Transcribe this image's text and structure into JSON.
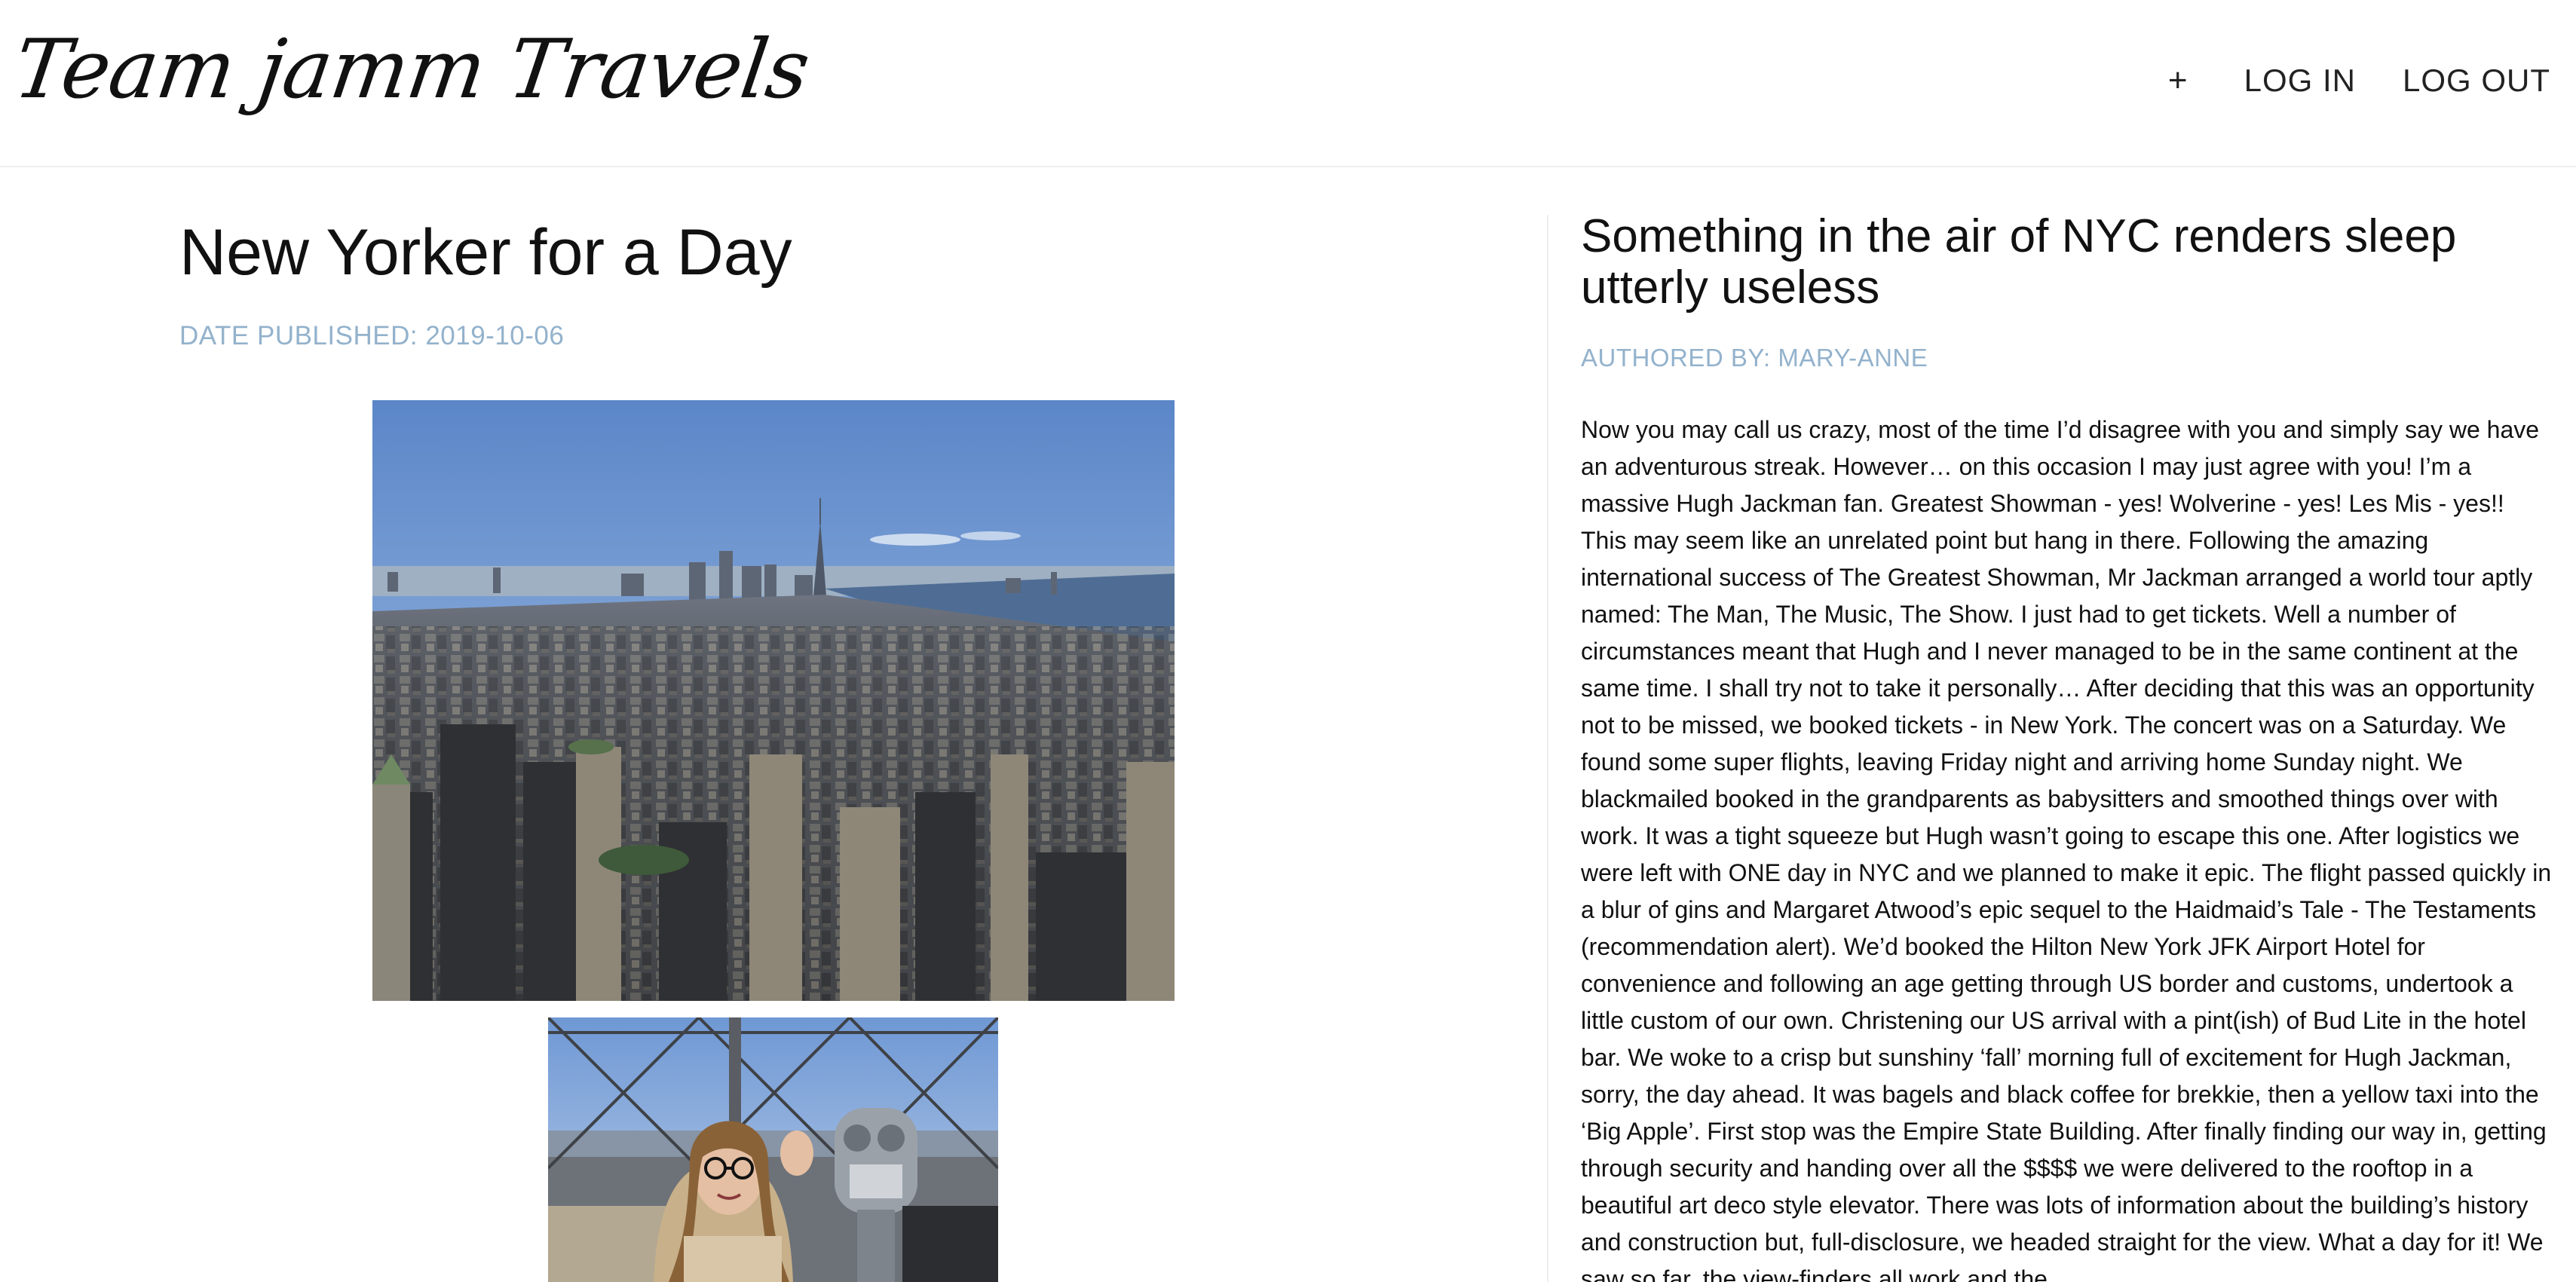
{
  "nav": {
    "logo": "Team jamm Travels",
    "plus_label": "+",
    "login_label": "LOG IN",
    "logout_label": "LOG OUT"
  },
  "post": {
    "title": "New Yorker for a Day",
    "date": "DATE PUBLISHED: 2019-10-06"
  },
  "article": {
    "title": "Something in the air of NYC renders sleep utterly useless",
    "author": "AUTHORED BY: MARY-ANNE",
    "body": "Now you may call us crazy, most of the time I’d disagree with you and simply say we have an adventurous streak. However… on this occasion I may just agree with you! I’m a massive Hugh Jackman fan. Greatest Showman - yes! Wolverine - yes! Les Mis - yes!! This may seem like an unrelated point but hang in there. Following the amazing international success of The Greatest Showman, Mr Jackman arranged a world tour aptly named: The Man, The Music, The Show. I just had to get tickets. Well a number of circumstances meant that Hugh and I never managed to be in the same continent at the same time. I shall try not to take it personally… After deciding that this was an opportunity not to be missed, we booked tickets - in New York. The concert was on a Saturday. We found some super flights, leaving Friday night and arriving home Sunday night. We blackmailed booked in the grandparents as babysitters and smoothed things over with work. It was a tight squeeze but Hugh wasn’t going to escape this one. After logistics we were left with ONE day in NYC and we planned to make it epic. The flight passed quickly in a blur of gins and Margaret Atwood’s epic sequel to the Haidmaid’s Tale - The Testaments (recommendation alert). We’d booked the Hilton New York JFK Airport Hotel for convenience and following an age getting through US border and customs, undertook a little custom of our own. Christening our US arrival with a pint(ish) of Bud Lite in the hotel bar. We woke to a crisp but sunshiny ‘fall’ morning full of excitement for Hugh Jackman, sorry, the day ahead. It was bagels and black coffee for brekkie, then a yellow taxi into the ‘Big Apple’. First stop was the Empire State Building. After finally finding our way in, getting through security and handing over all the $$$$ we were delivered to the rooftop in a beautiful art deco style elevator. There was lots of information about the building’s history and construction but, full-disclosure, we headed straight for the view. What a day for it! We saw so far, the view-finders all work and the"
  },
  "colors": {
    "accent_meta": "#93b2cc",
    "text": "#111111",
    "divider": "#eeeeee"
  }
}
